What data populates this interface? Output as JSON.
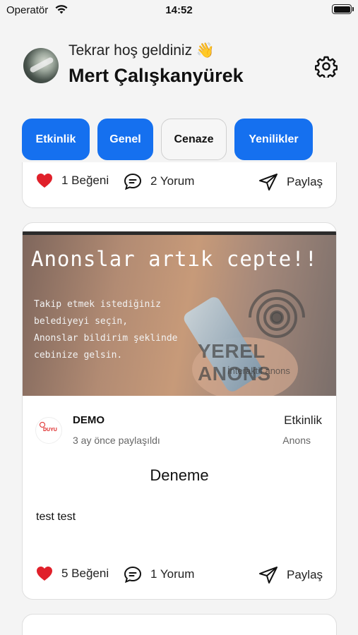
{
  "status_bar": {
    "carrier": "Operatör",
    "time": "14:52"
  },
  "header": {
    "greeting": "Tekrar hoş geldiniz 👋",
    "username": "Mert Çalışkanyürek"
  },
  "filters": [
    {
      "label": "Etkinlik",
      "active": true
    },
    {
      "label": "Genel",
      "active": true
    },
    {
      "label": "Cenaze",
      "active": false
    },
    {
      "label": "Yenilikler",
      "active": true
    }
  ],
  "posts": [
    {
      "likes": "1 Beğeni",
      "comments": "2 Yorum",
      "share": "Paylaş"
    },
    {
      "banner": {
        "headline": "Anonslar artık cepte!!",
        "lines": [
          "Takip etmek istediğiniz",
          "belediyeyi seçin,",
          "Anonslar bildirim şeklinde",
          "cebinize gelsin."
        ],
        "brand": "YEREL ANONS",
        "tagline": "İnteraktif anons"
      },
      "org_logo_text": "DUYU",
      "org_name": "DEMO",
      "posted": "3 ay önce paylaşıldı",
      "category": "Etkinlik",
      "type": "Anons",
      "title": "Deneme",
      "body": "test test",
      "likes": "5 Beğeni",
      "comments": "1 Yorum",
      "share": "Paylaş"
    }
  ],
  "colors": {
    "accent": "#1570ef",
    "like": "#e0202a"
  }
}
